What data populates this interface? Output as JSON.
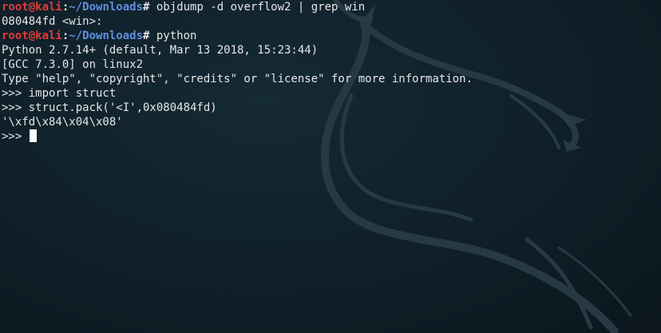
{
  "prompt": {
    "user_host": "root@kali",
    "colon": ":",
    "path": "~/Downloads",
    "symbol": "#"
  },
  "lines": [
    {
      "kind": "prompt",
      "command": " objdump -d overflow2 | grep win"
    },
    {
      "kind": "output",
      "text": "080484fd <win>:"
    },
    {
      "kind": "prompt",
      "command": " python"
    },
    {
      "kind": "output",
      "text": "Python 2.7.14+ (default, Mar 13 2018, 15:23:44)"
    },
    {
      "kind": "output",
      "text": "[GCC 7.3.0] on linux2"
    },
    {
      "kind": "output",
      "text": "Type \"help\", \"copyright\", \"credits\" or \"license\" for more information."
    },
    {
      "kind": "output",
      "text": ">>> import struct"
    },
    {
      "kind": "output",
      "text": ">>> struct.pack('<I',0x080484fd)"
    },
    {
      "kind": "output",
      "text": "'\\xfd\\x84\\x04\\x08'"
    },
    {
      "kind": "input",
      "text": ">>> "
    }
  ],
  "colors": {
    "background": "#10212b",
    "user": "#e03a3a",
    "path": "#5f8fe0",
    "text": "#e6e6e6"
  },
  "icons": [
    "kali-dragon-logo-watermark",
    "block-cursor"
  ]
}
